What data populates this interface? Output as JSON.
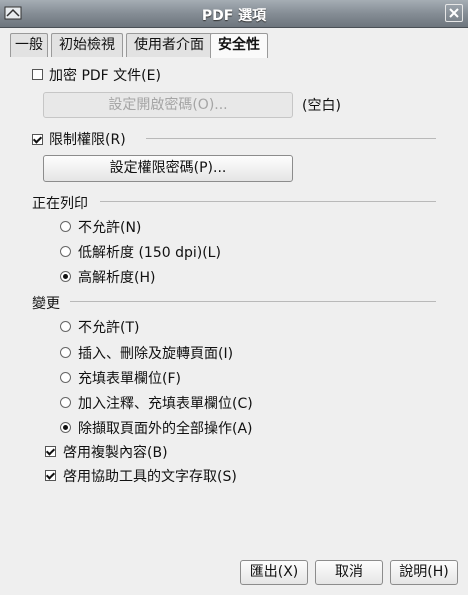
{
  "window": {
    "title": "PDF 選項"
  },
  "tabs": [
    {
      "label": "一般"
    },
    {
      "label": "初始檢視"
    },
    {
      "label": "使用者介面"
    },
    {
      "label": "安全性"
    }
  ],
  "encrypt": {
    "label": "加密 PDF 文件(E)",
    "checked": false,
    "set_open_password_button": "設定開啟密碼(O)...",
    "status": "(空白)"
  },
  "restrict": {
    "label": "限制權限(R)",
    "checked": true,
    "set_permission_password_button": "設定權限密碼(P)..."
  },
  "printing": {
    "heading": "正在列印",
    "options": [
      {
        "label": "不允許(N)",
        "selected": false
      },
      {
        "label": "低解析度 (150 dpi)(L)",
        "selected": false
      },
      {
        "label": "高解析度(H)",
        "selected": true
      }
    ]
  },
  "changes": {
    "heading": "變更",
    "options": [
      {
        "label": "不允許(T)",
        "selected": false
      },
      {
        "label": "插入、刪除及旋轉頁面(I)",
        "selected": false
      },
      {
        "label": "充填表單欄位(F)",
        "selected": false
      },
      {
        "label": "加入注釋、充填表單欄位(C)",
        "selected": false
      },
      {
        "label": "除擷取頁面外的全部操作(A)",
        "selected": true
      }
    ]
  },
  "copy": {
    "label": "啓用複製內容(B)",
    "checked": true
  },
  "accessibility": {
    "label": "啓用協助工具的文字存取(S)",
    "checked": true
  },
  "footer": {
    "export_button": "匯出(X)",
    "cancel_button": "取消",
    "help_button": "說明(H)"
  }
}
